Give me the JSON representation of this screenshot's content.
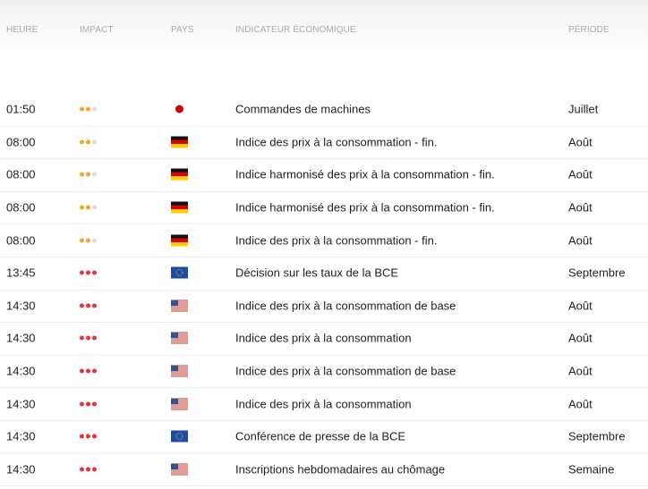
{
  "header": {
    "time": "HEURE",
    "impact": "IMPACT",
    "country": "PAYS",
    "indicator": "INDICATEUR ÉCONOMIQUE",
    "period": "PÉRIODE"
  },
  "colors": {
    "medium": "#f5a623",
    "high": "#e8333f",
    "empty": "#dddddd"
  },
  "rows": [
    {
      "time": "01:50",
      "impact": 2,
      "country": "jp",
      "indicator": "Commandes de machines",
      "period": "Juillet"
    },
    {
      "time": "08:00",
      "impact": 2,
      "country": "de",
      "indicator": "Indice des prix à la consommation - fin.",
      "period": "Août"
    },
    {
      "time": "08:00",
      "impact": 2,
      "country": "de",
      "indicator": "Indice harmonisé des prix à la consommation - fin.",
      "period": "Août"
    },
    {
      "time": "08:00",
      "impact": 2,
      "country": "de",
      "indicator": "Indice harmonisé des prix à la consommation - fin.",
      "period": "Août"
    },
    {
      "time": "08:00",
      "impact": 2,
      "country": "de",
      "indicator": "Indice des prix à la consommation - fin.",
      "period": "Août"
    },
    {
      "time": "13:45",
      "impact": 3,
      "country": "eu",
      "indicator": "Décision sur les taux de la BCE",
      "period": "Septembre"
    },
    {
      "time": "14:30",
      "impact": 3,
      "country": "us",
      "indicator": "Indice des prix à la consommation de base",
      "period": "Août"
    },
    {
      "time": "14:30",
      "impact": 3,
      "country": "us",
      "indicator": "Indice des prix à la consommation",
      "period": "Août"
    },
    {
      "time": "14:30",
      "impact": 3,
      "country": "us",
      "indicator": "Indice des prix à la consommation de base",
      "period": "Août"
    },
    {
      "time": "14:30",
      "impact": 3,
      "country": "us",
      "indicator": "Indice des prix à la consommation",
      "period": "Août"
    },
    {
      "time": "14:30",
      "impact": 3,
      "country": "eu",
      "indicator": "Conférence de presse de la BCE",
      "period": "Septembre"
    },
    {
      "time": "14:30",
      "impact": 3,
      "country": "us",
      "indicator": "Inscriptions hebdomadaires au chômage",
      "period": "Semaine"
    }
  ]
}
